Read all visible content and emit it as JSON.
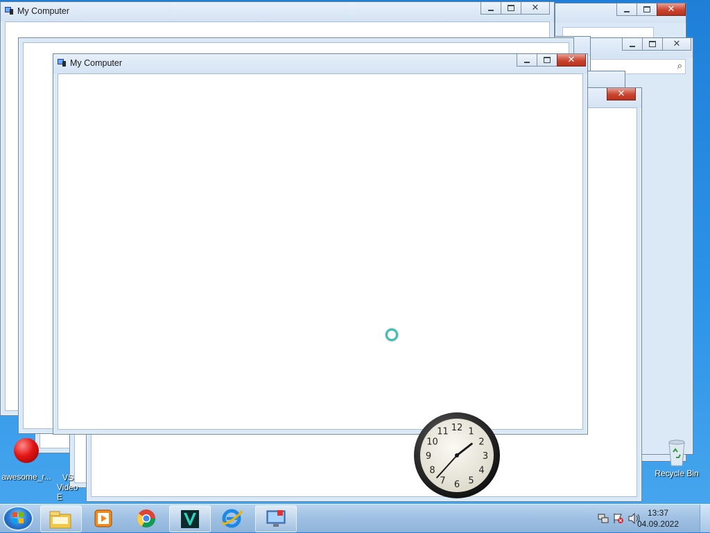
{
  "windows": {
    "back_title": "My Computer",
    "front_title": "My Computer"
  },
  "desktop_icons": {
    "awesome": "awesome_r...",
    "video_1": "VS",
    "video_2": "Video E",
    "recycle": "Recycle Bin"
  },
  "taskbar": {
    "time": "13:37",
    "date": "04.09.2022"
  },
  "gadget_clock": {
    "numbers": [
      "12",
      "1",
      "2",
      "3",
      "4",
      "5",
      "6",
      "7",
      "8",
      "9",
      "10",
      "11"
    ],
    "hour_hand_deg": 52,
    "minute_hand_deg": 222
  },
  "colors": {
    "accent": "#2c93e8",
    "close_button": "#c9452f"
  },
  "icons": [
    "window-app-icon",
    "start-orb-icon",
    "explorer-icon",
    "media-player-icon",
    "chrome-icon",
    "video-editor-icon",
    "ie-icon",
    "remote-desktop-icon",
    "network-icon",
    "action-center-icon",
    "volume-icon",
    "busy-cursor-icon",
    "recycle-bin-icon",
    "red-ball-icon"
  ]
}
